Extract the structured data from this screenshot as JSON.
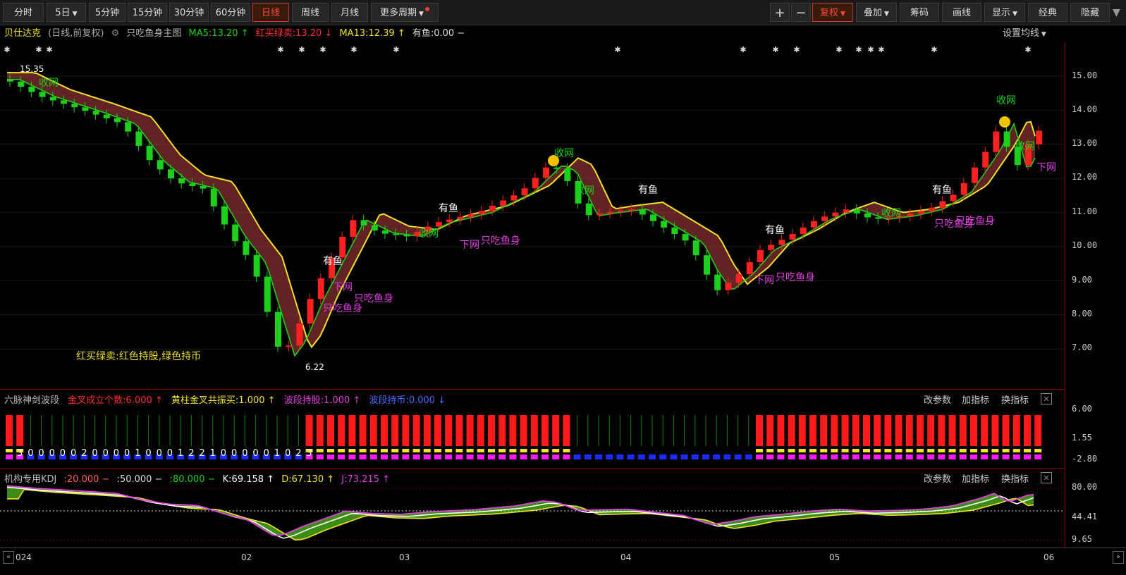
{
  "toolbar": {
    "left": [
      "分时",
      "5日",
      "5分钟",
      "15分钟",
      "30分钟",
      "60分钟",
      "日线",
      "周线",
      "月线",
      "更多周期"
    ],
    "active": "日线",
    "right": [
      "+",
      "−",
      "复权",
      "叠加",
      "筹码",
      "画线",
      "显示",
      "经典",
      "隐藏"
    ]
  },
  "legend": {
    "name": "贝仕达克",
    "mode": "(日线,前复权)",
    "indicator": "只吃鱼身主图",
    "ma5": "MA5:13.20 ↑",
    "hmlm": "红买绿卖:13.20 ↓",
    "ma13": "MA13:12.39 ↑",
    "youyu": "有鱼:0.00 −",
    "settings": "设置均线"
  },
  "main_chart": {
    "y_axis": [
      "15.00",
      "14.00",
      "13.00",
      "12.00",
      "11.00",
      "10.00",
      "9.00",
      "8.00",
      "7.00"
    ],
    "high_label": "15.35",
    "low_label": "6.22",
    "note": "红买绿卖:红色持股,绿色持币",
    "labels": {
      "shouwang": "收网",
      "youyu": "有鱼",
      "xiawang": "下网",
      "zhichi": "只吃鱼身"
    }
  },
  "panel2": {
    "title": "六脉神剑波段",
    "jincha": "金叉成立个数:6.000 ↑",
    "huangzhu": "黄柱金叉共振买:1.000 ↑",
    "boduan_chi": "波段持股:1.000 ↑",
    "boduan_bi": "波段持币:0.000 ↓",
    "y_axis": [
      "6.00",
      "1.55",
      "-2.80"
    ],
    "digits": "3 0 0 0 0 0 2 0 0 0 0 1 0 0 0 1 2 2 1 0 0 0 0 0 1 0 2 3"
  },
  "panel3": {
    "title": "机构专用KDJ",
    "l20": ":20.000 −",
    "l50": ":50.000 −",
    "l80": ":80.000 −",
    "k": "K:69.158 ↑",
    "d": "D:67.130 ↑",
    "j": "J:73.215 ↑",
    "y_axis": [
      "80.00",
      "44.41",
      "9.65"
    ]
  },
  "panel_buttons": [
    "改参数",
    "加指标",
    "换指标"
  ],
  "x_axis": [
    "024",
    "02",
    "03",
    "04",
    "05",
    "06"
  ],
  "colors": {
    "up": "#ff2020",
    "down": "#19d219",
    "ma5": "#ff2020",
    "ma13": "#f2e22a",
    "fill": "#b04040",
    "magenta": "#e040e0"
  }
}
